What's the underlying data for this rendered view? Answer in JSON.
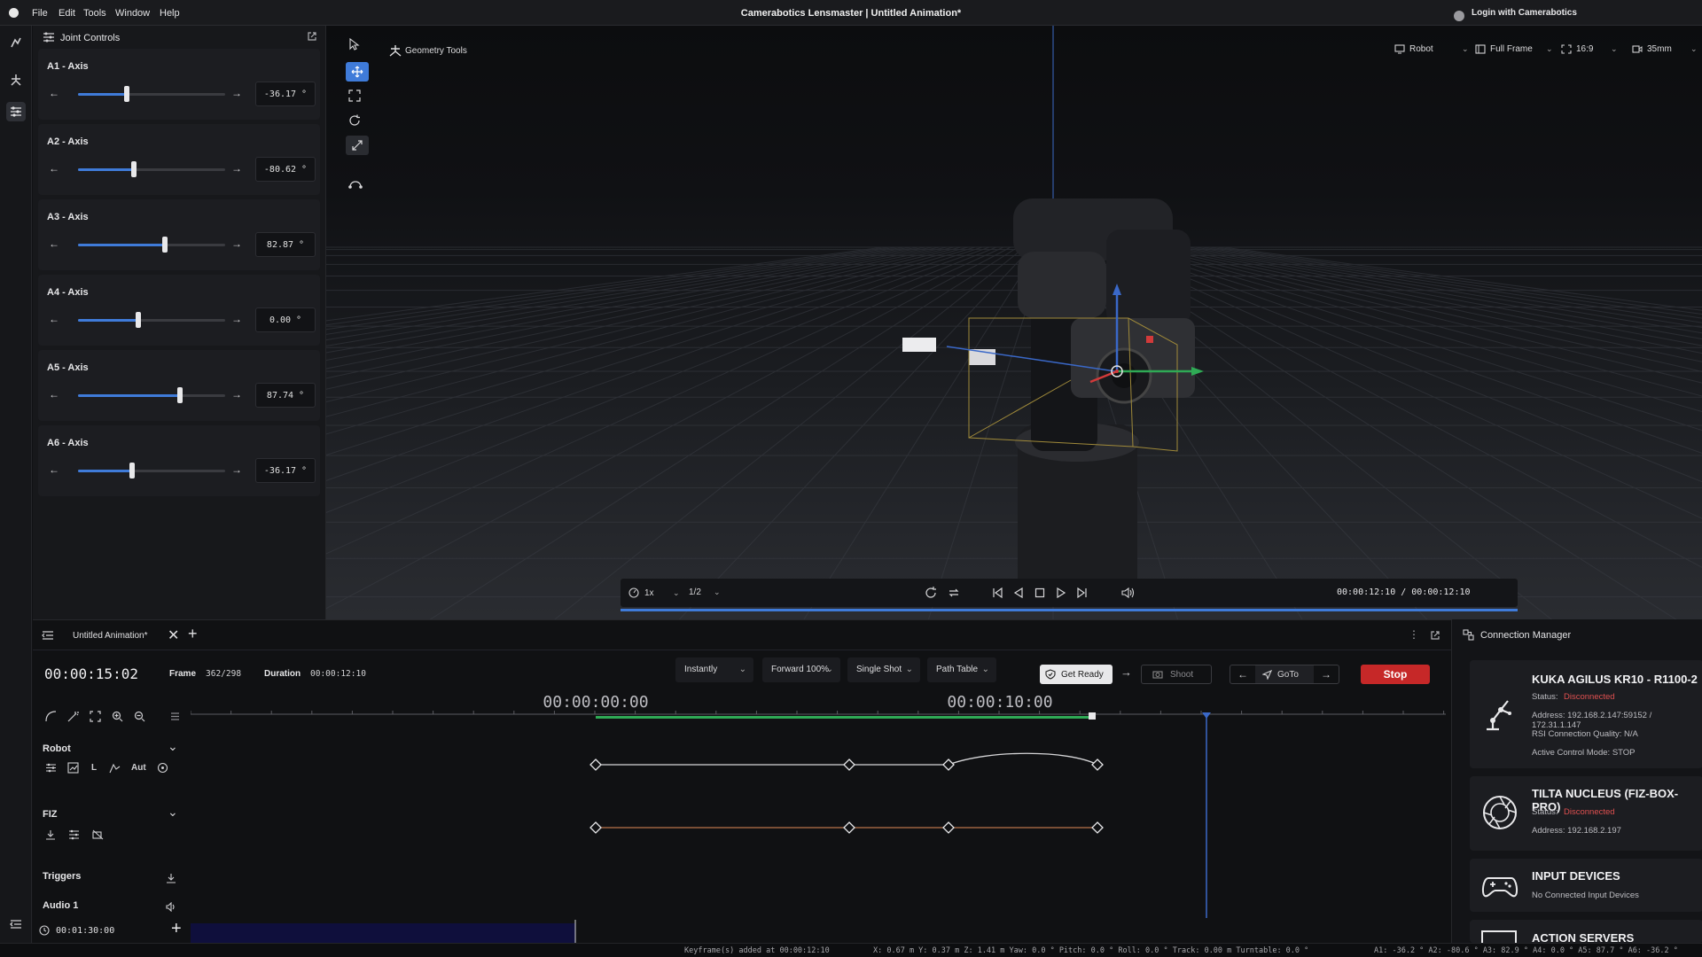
{
  "app": {
    "title": "Camerabotics Lensmaster | Untitled Animation*",
    "menu": [
      "File",
      "Edit",
      "Tools",
      "Window",
      "Help"
    ],
    "login_label": "Login with Camerabotics"
  },
  "joint_panel": {
    "title": "Joint Controls",
    "axes": [
      {
        "label": "A1 - Axis",
        "value": "-36.17 °",
        "level": 0.33
      },
      {
        "label": "A2 - Axis",
        "value": "-80.62 °",
        "level": 0.38
      },
      {
        "label": "A3 - Axis",
        "value": "82.87 °",
        "level": 0.59
      },
      {
        "label": "A4 - Axis",
        "value": "0.00 °",
        "level": 0.41
      },
      {
        "label": "A5 - Axis",
        "value": "87.74 °",
        "level": 0.69
      },
      {
        "label": "A6 - Axis",
        "value": "-36.17 °",
        "level": 0.37
      }
    ]
  },
  "viewport": {
    "geometry_tools_label": "Geometry Tools",
    "top_right": {
      "robot": "Robot",
      "frame": "Full Frame",
      "aspect": "16:9",
      "lens": "35mm"
    },
    "playback": {
      "speed": "1x",
      "resolution": "1/2",
      "timecode": "00:00:12:10 / 00:00:12:10",
      "progress": 1.0
    }
  },
  "timeline": {
    "tab_title": "Untitled Animation*",
    "current_time": "00:00:15:02",
    "frame_label": "Frame",
    "frame_value": "362/298",
    "duration_label": "Duration",
    "duration_value": "00:00:12:10",
    "move_mode": "Instantly",
    "direction": "Forward 100%",
    "shot_mode": "Single Shot",
    "path_table": "Path Table",
    "get_ready": "Get Ready",
    "shoot": "Shoot",
    "goto": "GoTo",
    "stop": "Stop",
    "ruler_marks": [
      "00:00:00:00",
      "00:00:10:00"
    ],
    "tracks": {
      "robot_label": "Robot",
      "robot_aut_label": "Aut",
      "robot_l_label": "L",
      "fiz_label": "FIZ",
      "triggers_label": "Triggers",
      "audio_label": "Audio 1",
      "audio_time": "00:01:30:00"
    }
  },
  "connection_manager": {
    "title": "Connection Manager",
    "devices": [
      {
        "name": "KUKA AGILUS KR10 - R1100-2",
        "status_label": "Status:",
        "status": "Disconnected",
        "address": "Address: 192.168.2.147:59152 / 172.31.1.147",
        "quality": "RSI Connection Quality: N/A",
        "mode": "Active Control Mode: STOP"
      },
      {
        "name": "TILTA NUCLEUS (FIZ-BOX-PRO)",
        "status_label": "Status:",
        "status": "Disconnected",
        "address": "Address: 192.168.2.197"
      },
      {
        "name": "INPUT DEVICES",
        "info": "No Connected Input Devices"
      },
      {
        "name": "ACTION SERVERS"
      }
    ]
  },
  "status_bar": {
    "message": "Keyframe(s) added at 00:00:12:10",
    "pose": "X: 0.67 m Y: 0.37 m Z: 1.41 m Yaw: 0.0 ° Pitch: 0.0 ° Roll: 0.0 ° Track: 0.00 m Turntable: 0.0 °",
    "joints": "A1: -36.2 ° A2: -80.6 ° A3: 82.9 ° A4: 0.0 ° A5: 87.7 ° A6: -36.2 °"
  },
  "colors": {
    "accent": "#3f7bd9",
    "stop": "#c62828",
    "disconnected": "#e05050",
    "fiz_curve": "#b8734a"
  }
}
